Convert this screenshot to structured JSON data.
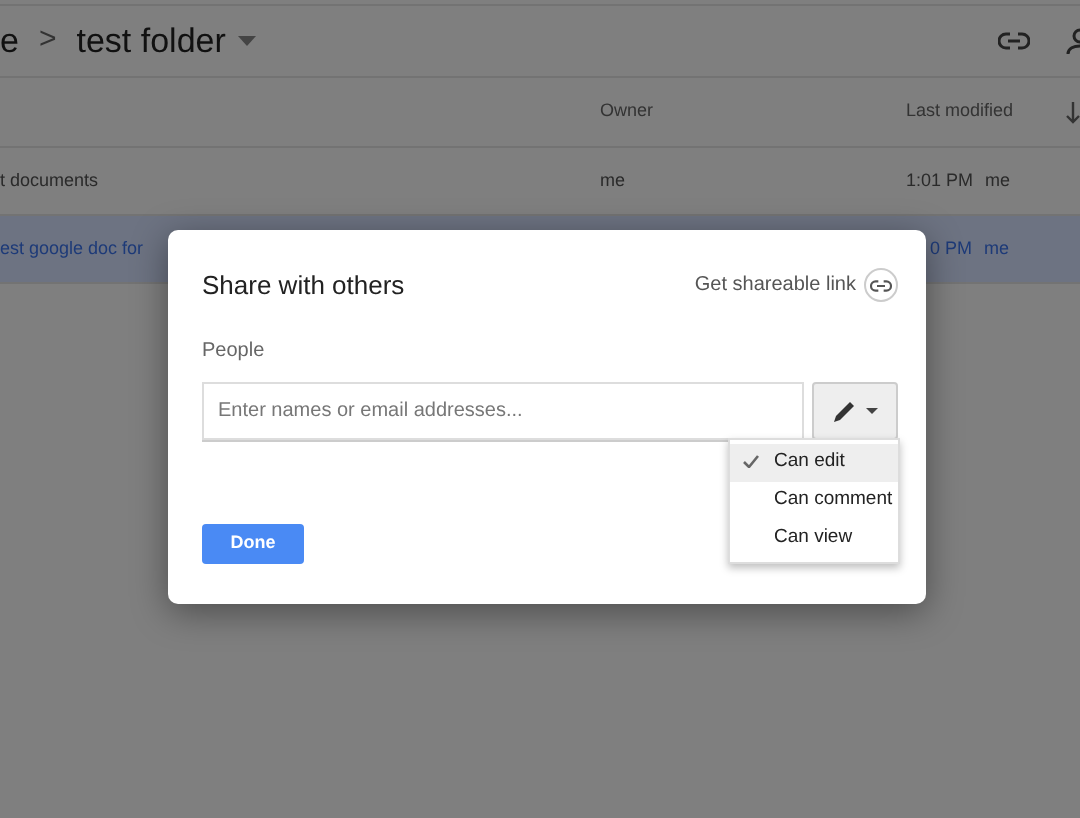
{
  "toolbar": {
    "breadcrumb": [
      {
        "label": "e"
      },
      {
        "label": "test folder"
      }
    ],
    "separator": ">"
  },
  "table": {
    "columns": [
      "Owner",
      "Last modified"
    ],
    "rows": [
      {
        "name": "t documents",
        "owner": "me",
        "modified": "1:01 PM",
        "modified_by": "me",
        "selected": false
      },
      {
        "name": "est google doc for",
        "modified": "0 PM",
        "modified_by": "me",
        "selected": true
      }
    ]
  },
  "dialog": {
    "title": "Share with others",
    "link_label": "Get shareable link",
    "people_label": "People",
    "input": {
      "placeholder": "Enter names or email addresses..."
    },
    "menu": [
      {
        "label": "Can edit",
        "selected": true
      },
      {
        "label": "Can comment",
        "selected": false
      },
      {
        "label": "Can view",
        "selected": false
      }
    ],
    "done": "Done"
  }
}
